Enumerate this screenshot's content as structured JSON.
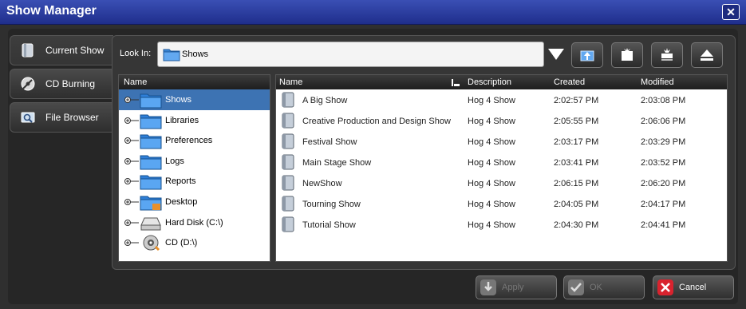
{
  "window": {
    "title": "Show Manager"
  },
  "left_tabs": [
    {
      "label": "Current Show",
      "icon": "show-file-icon"
    },
    {
      "label": "CD Burning",
      "icon": "cd-burning-icon"
    },
    {
      "label": "File Browser",
      "icon": "file-browser-icon"
    }
  ],
  "lookin": {
    "label": "Look In:",
    "value": "Shows"
  },
  "tree": {
    "header": "Name",
    "items": [
      {
        "label": "Shows",
        "icon": "folder-icon",
        "selected": true
      },
      {
        "label": "Libraries",
        "icon": "folder-icon"
      },
      {
        "label": "Preferences",
        "icon": "folder-icon"
      },
      {
        "label": "Logs",
        "icon": "folder-icon"
      },
      {
        "label": "Reports",
        "icon": "folder-icon"
      },
      {
        "label": "Desktop",
        "icon": "desktop-folder-icon"
      },
      {
        "label": "Hard Disk (C:\\)",
        "icon": "hard-disk-icon"
      },
      {
        "label": "CD (D:\\)",
        "icon": "cd-drive-icon"
      }
    ]
  },
  "list": {
    "columns": [
      "Name",
      "Description",
      "Created",
      "Modified"
    ],
    "rows": [
      {
        "name": "A Big Show",
        "description": "Hog 4 Show",
        "created": "2:02:57 PM",
        "modified": "2:03:08 PM"
      },
      {
        "name": "Creative Production and Design Show",
        "description": "Hog 4 Show",
        "created": "2:05:55 PM",
        "modified": "2:06:06 PM"
      },
      {
        "name": "Festival Show",
        "description": "Hog 4 Show",
        "created": "2:03:17 PM",
        "modified": "2:03:29 PM"
      },
      {
        "name": "Main Stage Show",
        "description": "Hog 4 Show",
        "created": "2:03:41 PM",
        "modified": "2:03:52 PM"
      },
      {
        "name": "NewShow",
        "description": "Hog 4 Show",
        "created": "2:06:15 PM",
        "modified": "2:06:20 PM"
      },
      {
        "name": "Tourning Show",
        "description": "Hog 4 Show",
        "created": "2:04:05 PM",
        "modified": "2:04:17 PM"
      },
      {
        "name": "Tutorial Show",
        "description": "Hog 4 Show",
        "created": "2:04:30 PM",
        "modified": "2:04:41 PM"
      }
    ]
  },
  "buttons": {
    "apply": "Apply",
    "ok": "OK",
    "cancel": "Cancel"
  },
  "colors": {
    "titlebar": "#2a3da0",
    "selection": "#3d73b3",
    "cancel_icon": "#d9232e"
  }
}
